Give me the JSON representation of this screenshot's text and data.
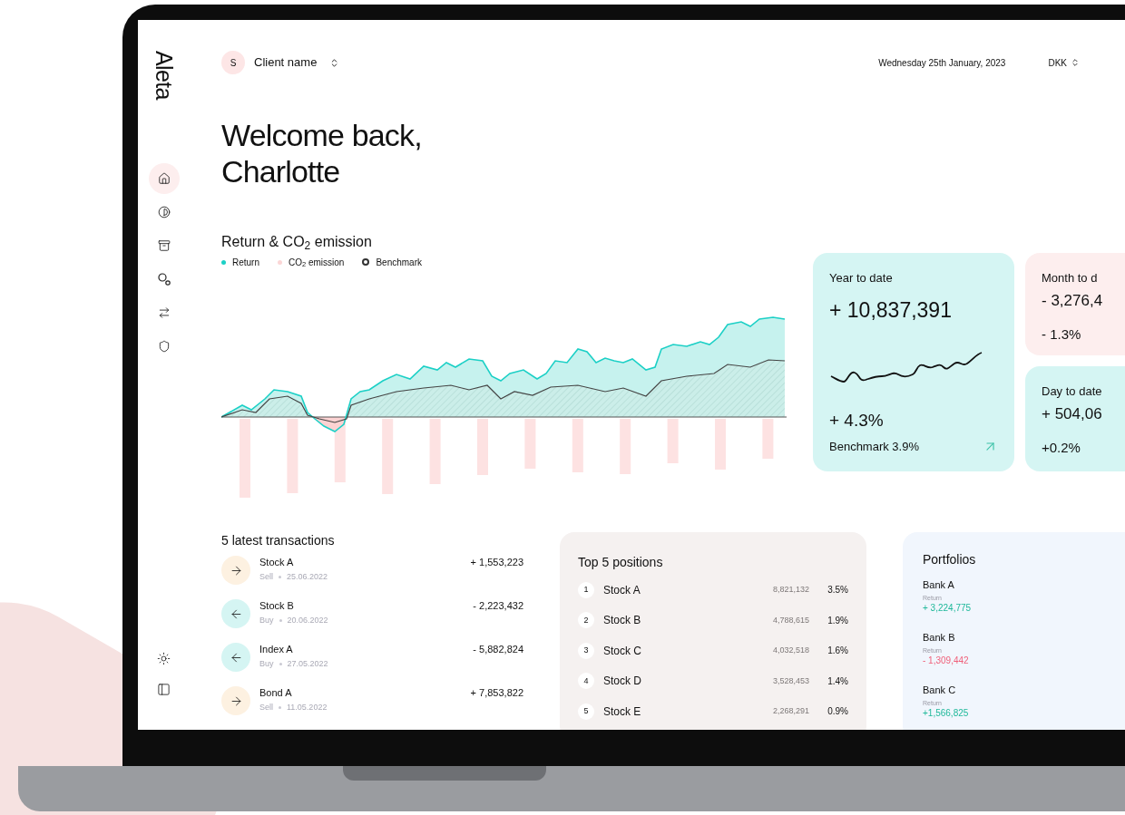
{
  "brand": "Aleta",
  "sidebar": {
    "nav": [
      {
        "selected": true
      },
      {
        "selected": false
      },
      {
        "selected": false
      },
      {
        "selected": false
      },
      {
        "selected": false
      },
      {
        "selected": false
      }
    ]
  },
  "header": {
    "client_initial": "S",
    "client_name": "Client name",
    "date": "Wednesday 25th January, 2023",
    "currency": "DKK"
  },
  "greeting": [
    "Welcome back,",
    "Charlotte"
  ],
  "chart": {
    "title": "Return & CO$_{2}$ emission",
    "legend": [
      {
        "label": "Return",
        "kind": "dot",
        "color": "#1cd0c6"
      },
      {
        "label": "CO$_{2}$ emission",
        "kind": "dot",
        "color": "#fbd6d6"
      },
      {
        "label": "Benchmark",
        "kind": "ring",
        "color": "#333333"
      }
    ]
  },
  "summary_cards": [
    {
      "kind": "large",
      "title": "Year to date",
      "value": "+ 10,837,391",
      "change": "+ 4.3%",
      "benchmark": "Benchmark 3.9%",
      "color": "#d5f5f3"
    },
    {
      "kind": "small",
      "title": "Month to d",
      "value": "- 3,276,4",
      "change": "- 1.3%",
      "color": "#fdeeee"
    },
    {
      "kind": "small",
      "title": "Day to date",
      "value": "+ 504,06",
      "change": "+0.2%",
      "color": "#d5f5f3"
    }
  ],
  "transactions": {
    "title": "5 latest transactions",
    "rows": [
      {
        "kind": "sell",
        "name": "Stock A",
        "type": "Sell",
        "date": "25.06.2022",
        "amount": "+ 1,553,223"
      },
      {
        "kind": "buy",
        "name": "Stock B",
        "type": "Buy",
        "date": "20.06.2022",
        "amount": "- 2,223,432"
      },
      {
        "kind": "buy",
        "name": "Index A",
        "type": "Buy",
        "date": "27.05.2022",
        "amount": "- 5,882,824"
      },
      {
        "kind": "sell",
        "name": "Bond A",
        "type": "Sell",
        "date": "11.05.2022",
        "amount": "+ 7,853,822"
      }
    ]
  },
  "top_positions": {
    "title": "Top 5 positions",
    "rows": [
      {
        "rank": "1",
        "name": "Stock A",
        "value": "8,821,132",
        "share": "3.5%"
      },
      {
        "rank": "2",
        "name": "Stock B",
        "value": "4,788,615",
        "share": "1.9%"
      },
      {
        "rank": "3",
        "name": "Stock C",
        "value": "4,032,518",
        "share": "1.6%"
      },
      {
        "rank": "4",
        "name": "Stock D",
        "value": "3,528,453",
        "share": "1.4%"
      },
      {
        "rank": "5",
        "name": "Stock E",
        "value": "2,268,291",
        "share": "0.9%"
      }
    ]
  },
  "portfolios": {
    "title": "Portfolios",
    "items": [
      {
        "name": "Bank A",
        "label": "Return",
        "value": "+ 3,224,775",
        "color": "#1fb89a"
      },
      {
        "name": "Bank B",
        "label": "Return",
        "value": "- 1,309,442",
        "color": "#f0607a"
      },
      {
        "name": "Bank C",
        "label": "Return",
        "value": "+1,566,825",
        "color": "#1fb89a"
      }
    ]
  }
}
